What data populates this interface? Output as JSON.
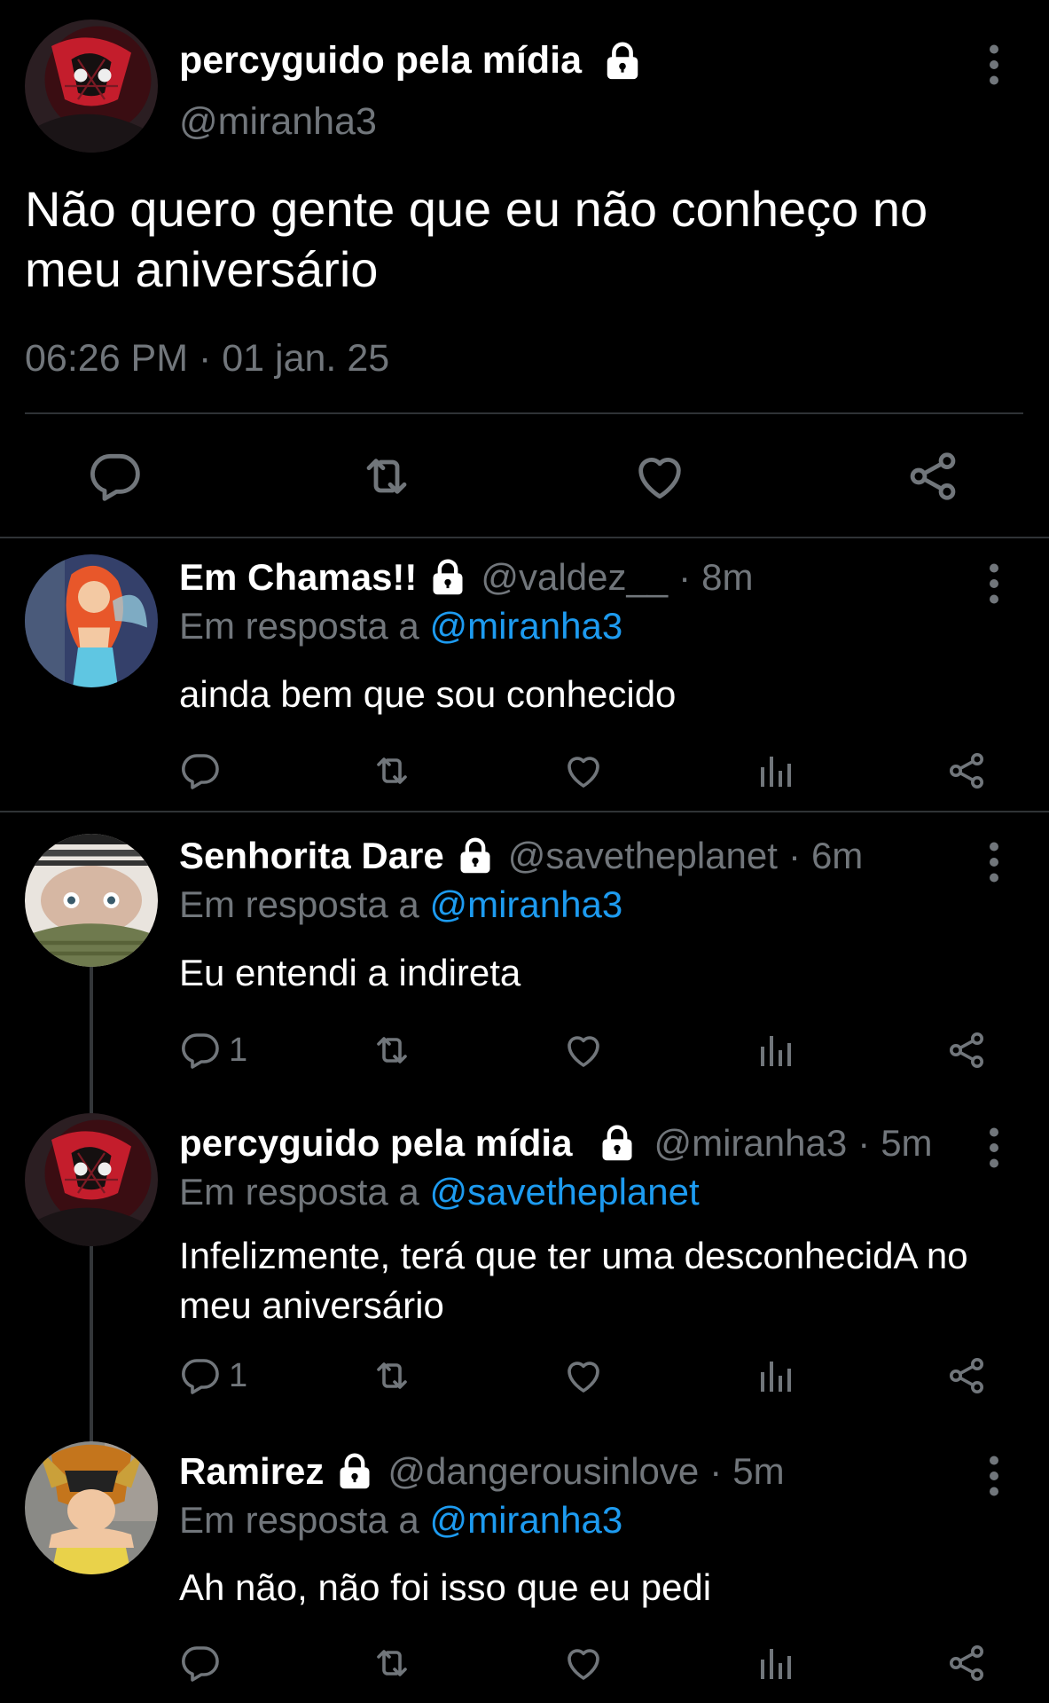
{
  "main_tweet": {
    "display_name": "percyguido pela mídia",
    "handle": "@miranha3",
    "text": "Não quero gente que eu não conheço no meu aniversário",
    "timestamp": "06:26 PM · 01 jan. 25",
    "actions": [
      "reply-icon",
      "retweet-icon",
      "like-icon",
      "share-icon"
    ]
  },
  "replies": [
    {
      "display_name": "Em Chamas!!",
      "handle": "@valdez__",
      "separator": "·",
      "time": "8m",
      "reply_prefix": "Em resposta a",
      "reply_to": "@miranha3",
      "text": "ainda bem que sou conhecido",
      "reply_count": ""
    },
    {
      "display_name": "Senhorita Dare",
      "handle": "@savetheplanet",
      "separator": "·",
      "time": "6m",
      "reply_prefix": "Em resposta a",
      "reply_to": "@miranha3",
      "text": "Eu entendi a indireta",
      "reply_count": "1"
    },
    {
      "display_name": "percyguido pela mídia",
      "handle": "@miranha3",
      "separator": "·",
      "time": "5m",
      "reply_prefix": "Em resposta a",
      "reply_to": "@savetheplanet",
      "text": "Infelizmente, terá que ter uma desconhecidA no meu aniversário",
      "reply_count": "1"
    },
    {
      "display_name": "Ramirez",
      "handle": "@dangerousinlove",
      "separator": "·",
      "time": "5m",
      "reply_prefix": "Em resposta a",
      "reply_to": "@miranha3",
      "text": "Ah não, não foi isso que eu pedi",
      "reply_count": ""
    }
  ],
  "colors": {
    "background": "#000000",
    "text_primary": "#ffffff",
    "text_secondary": "#71767b",
    "link": "#1d9bf0",
    "divider": "#2f3336"
  }
}
